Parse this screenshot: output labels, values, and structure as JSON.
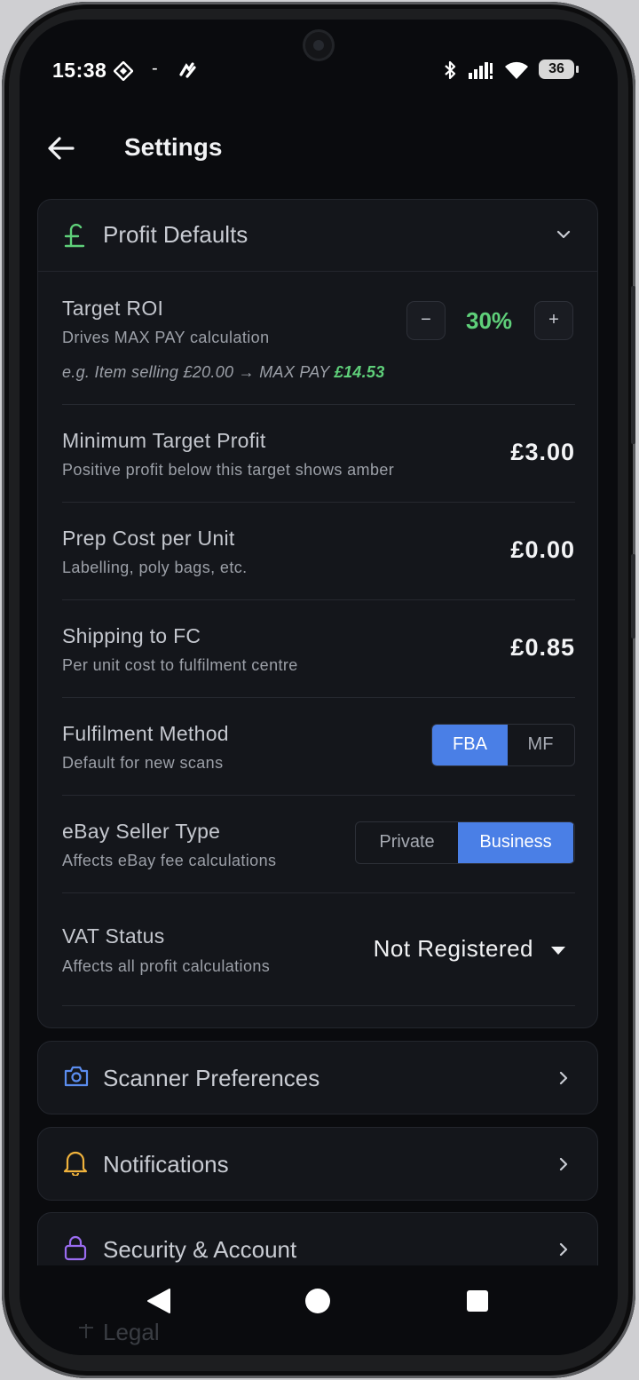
{
  "status_bar": {
    "time": "15:38",
    "separator": "-",
    "battery": "36"
  },
  "header": {
    "title": "Settings"
  },
  "profit_defaults": {
    "title": "Profit Defaults",
    "target_roi": {
      "label": "Target ROI",
      "description": "Drives MAX PAY calculation",
      "value": "30%",
      "minus": "−",
      "plus": "+",
      "example_prefix": "e.g. Item selling £20.00 → MAX PAY ",
      "example_value": "£14.53"
    },
    "min_profit": {
      "label": "Minimum Target Profit",
      "description": "Positive profit below this target shows amber",
      "value": "£3.00"
    },
    "prep_cost": {
      "label": "Prep Cost per Unit",
      "description": "Labelling, poly bags, etc.",
      "value": "£0.00"
    },
    "shipping": {
      "label": "Shipping to FC",
      "description": "Per unit cost to fulfilment centre",
      "value": "£0.85"
    },
    "fulfilment": {
      "label": "Fulfilment Method",
      "description": "Default for new scans",
      "options": [
        "FBA",
        "MF"
      ],
      "selected": "FBA"
    },
    "ebay_seller": {
      "label": "eBay Seller Type",
      "description": "Affects eBay fee calculations",
      "options": [
        "Private",
        "Business"
      ],
      "selected": "Business"
    },
    "vat": {
      "label": "VAT Status",
      "description": "Affects all profit calculations",
      "value": "Not Registered"
    }
  },
  "sections": [
    {
      "label": "Scanner Preferences",
      "icon": "camera-icon",
      "color": "#5b8def"
    },
    {
      "label": "Notifications",
      "icon": "bell-icon",
      "color": "#f0b23c"
    },
    {
      "label": "Security & Account",
      "icon": "lock-icon",
      "color": "#9a6cf0"
    },
    {
      "label": "Legal",
      "icon": "scale-icon",
      "color": "#3a3d43"
    }
  ],
  "colors": {
    "accent_green": "#5fd07a",
    "accent_blue": "#4a7fe6",
    "background": "#0a0b0e"
  }
}
